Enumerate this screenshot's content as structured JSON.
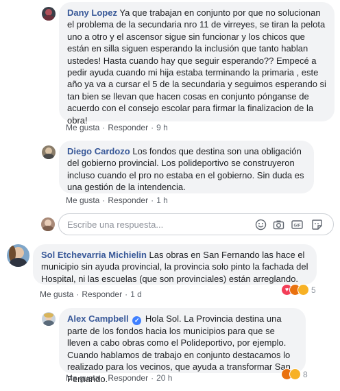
{
  "comments": [
    {
      "author": "Dany Lopez",
      "text": "Ya que trabajan en conjunto por que no solucionan el problema de la secundaria nro 11 de virreyes, se tiran la pelota uno a otro y el ascensor sigue sin funcionar y los chicos que están en silla siguen esperando la inclusión que tanto hablan ustedes! Hasta cuando hay que seguir esperando?? Empecé a pedir ayuda cuando mi hija estaba terminando la primaria , este año ya va a cursar el 5 de la secundaria y seguimos esperando si tan bien se llevan que hacen cosas en conjunto pónganse de acuerdo con el consejo escolar para firmar la finalizacion de la obra!",
      "like": "Me gusta",
      "reply": "Responder",
      "time": "9 h"
    },
    {
      "author": "Diego Cardozo",
      "text": "Los fondos que destina son una obligación del gobierno provincial. Los polideportivo se construyeron incluso cuando el pro no estaba en el gobierno. Sin duda es una gestión de la intendencia.",
      "like": "Me gusta",
      "reply": "Responder",
      "time": "1 h"
    },
    {
      "author": "Sol Etchevarria Michielin",
      "text": "Las obras en San Fernando las hace el municipio sin ayuda provincial, la provincia solo pinto la fachada del Hospital, ni las escuelas (que son provinciales) están arreglando.",
      "like": "Me gusta",
      "reply": "Responder",
      "time": "1 d",
      "reaction_count": "5"
    },
    {
      "author": "Alex Campbell",
      "text": "Hola Sol. La Provincia destina una parte de los fondos hacia los municipios para que se lleven a cabo obras como el Polideportivo, por ejemplo. Cuando hablamos de trabajo en conjunto destacamos lo realizado para los vecinos, que ayuda a transformar San Fernando.",
      "like": "Me gusta",
      "reply": "Responder",
      "time": "20 h",
      "reaction_count": "8"
    }
  ],
  "reply_box": {
    "placeholder": "Escribe una respuesta..."
  },
  "icons": [
    "emoji-icon",
    "camera-icon",
    "gif-icon",
    "sticker-icon"
  ],
  "colors": {
    "author": "#385898",
    "bubble": "#f2f3f5",
    "meta": "#606770",
    "verified": "#4080ff"
  }
}
